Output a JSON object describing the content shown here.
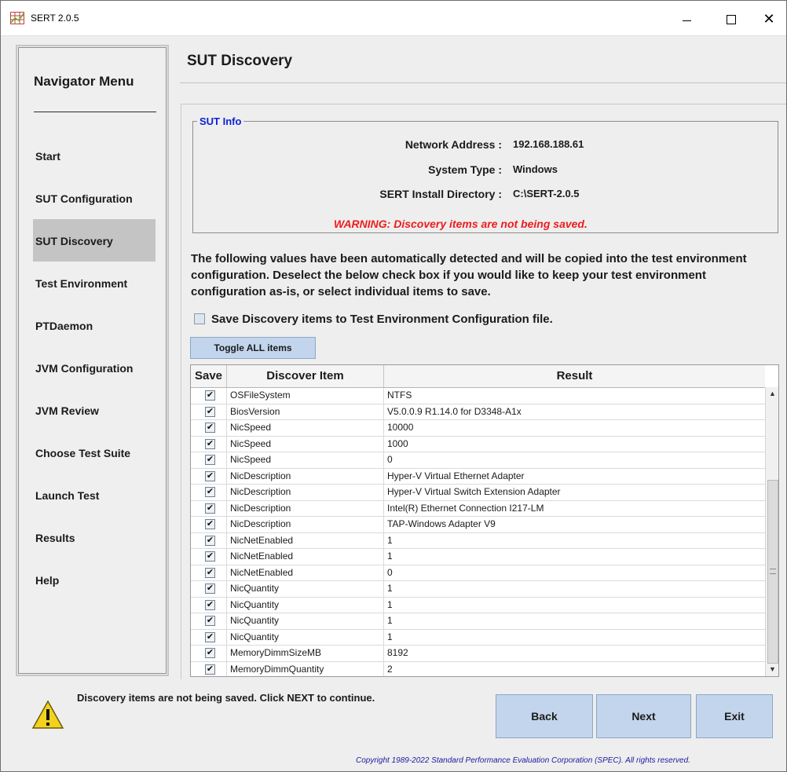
{
  "window": {
    "title": "SERT 2.0.5",
    "close_glyph": "✕",
    "icons": [
      "app-icon",
      "minimize-icon",
      "maximize-icon",
      "close-icon"
    ]
  },
  "nav": {
    "title": "Navigator Menu",
    "items": [
      {
        "label": "Start"
      },
      {
        "label": "SUT Configuration"
      },
      {
        "label": "SUT Discovery"
      },
      {
        "label": "Test Environment"
      },
      {
        "label": "PTDaemon"
      },
      {
        "label": "JVM Configuration"
      },
      {
        "label": "JVM Review"
      },
      {
        "label": "Choose Test Suite"
      },
      {
        "label": "Launch Test"
      },
      {
        "label": "Results"
      },
      {
        "label": "Help"
      }
    ],
    "active": "SUT Discovery"
  },
  "header": {
    "title": "SUT Discovery"
  },
  "sut_info": {
    "legend": "SUT Info",
    "network_label": "Network Address :",
    "network_value": "192.168.188.61",
    "system_label": "System Type :",
    "system_value": "Windows",
    "dir_label": "SERT Install Directory :",
    "dir_value": "C:\\SERT-2.0.5",
    "warning": "WARNING: Discovery items are not being saved."
  },
  "description": "The following values have been automatically detected and will be copied into the test environment configuration. Deselect the below check box if you would like to keep your test environment configuration as-is, or select individual items to save.",
  "save_checkbox": {
    "label": "Save Discovery items to Test Environment Configuration file.",
    "checked": false
  },
  "toggle_button": "Toggle ALL items",
  "table": {
    "headers": [
      "Save",
      "Discover Item",
      "Result"
    ],
    "check_glyph": "✔",
    "rows": [
      {
        "item": "OSFileSystem",
        "result": "NTFS",
        "checked": true
      },
      {
        "item": "BiosVersion",
        "result": "V5.0.0.9 R1.14.0 for D3348-A1x",
        "checked": true
      },
      {
        "item": "NicSpeed",
        "result": "10000",
        "checked": true
      },
      {
        "item": "NicSpeed",
        "result": "1000",
        "checked": true
      },
      {
        "item": "NicSpeed",
        "result": "0",
        "checked": true
      },
      {
        "item": "NicDescription",
        "result": "Hyper-V Virtual Ethernet Adapter",
        "checked": true
      },
      {
        "item": "NicDescription",
        "result": "Hyper-V Virtual Switch Extension Adapter",
        "checked": true
      },
      {
        "item": "NicDescription",
        "result": "Intel(R) Ethernet Connection I217-LM",
        "checked": true
      },
      {
        "item": "NicDescription",
        "result": "TAP-Windows Adapter V9",
        "checked": true
      },
      {
        "item": "NicNetEnabled",
        "result": "1",
        "checked": true
      },
      {
        "item": "NicNetEnabled",
        "result": "1",
        "checked": true
      },
      {
        "item": "NicNetEnabled",
        "result": "0",
        "checked": true
      },
      {
        "item": "NicQuantity",
        "result": "1",
        "checked": true
      },
      {
        "item": "NicQuantity",
        "result": "1",
        "checked": true
      },
      {
        "item": "NicQuantity",
        "result": "1",
        "checked": true
      },
      {
        "item": "NicQuantity",
        "result": "1",
        "checked": true
      },
      {
        "item": "MemoryDimmSizeMB",
        "result": "8192",
        "checked": true
      },
      {
        "item": "MemoryDimmQuantity",
        "result": "2",
        "checked": true
      }
    ]
  },
  "status": {
    "message": "Discovery items are not being saved. Click NEXT to continue.",
    "icon": "warning-icon"
  },
  "buttons": {
    "back": "Back",
    "next": "Next",
    "exit": "Exit"
  },
  "copyright": "Copyright 1989-2022 Standard Performance Evaluation Corporation (SPEC). All rights reserved.",
  "colors": {
    "accent_button": "#c2d5ec",
    "active_nav": "#c4c4c4",
    "warning_text": "#ee1c1c",
    "legend_text": "#0b22d4",
    "copyright_text": "#1b1ba0"
  }
}
